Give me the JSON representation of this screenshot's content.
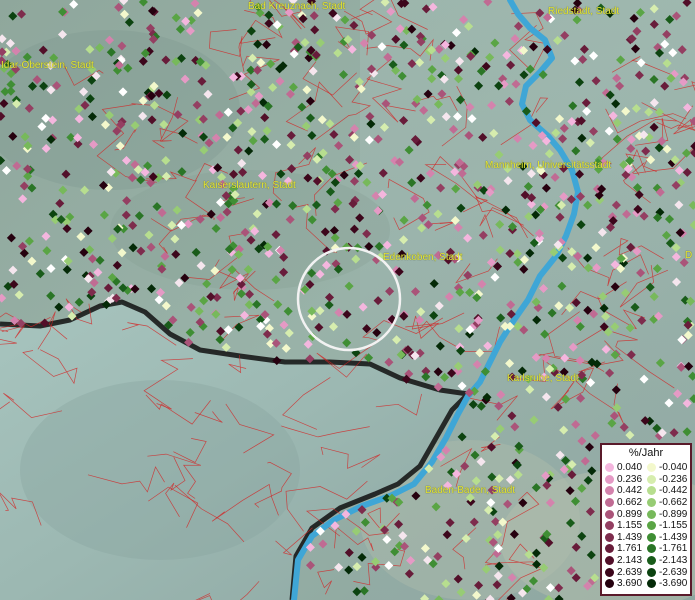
{
  "map": {
    "cities": [
      {
        "name": "Bad Kreuznach, Stadt"
      },
      {
        "name": "Riedstadt, Stadt"
      },
      {
        "name": "Idar-Oberstein, Stadt"
      },
      {
        "name": "Mannheim, Universitätsstadt"
      },
      {
        "name": "Kaiserslautern, Stadt"
      },
      {
        "name": "Edenkoben, Stadt"
      },
      {
        "name": "Karlsruhe, Stadt"
      },
      {
        "name": "Baden-Baden, Stadt"
      },
      {
        "name": "D"
      }
    ],
    "colors": {
      "city_label": "#e6e633",
      "boundary": "#d42020",
      "river": "#3fa6d6",
      "border": "#111111"
    }
  },
  "legend": {
    "title": "%/Jahr",
    "positive": [
      {
        "label": "0.040",
        "color": "#f4b6de"
      },
      {
        "label": "0.236",
        "color": "#e59ac5"
      },
      {
        "label": "0.442",
        "color": "#d483ad"
      },
      {
        "label": "0.662",
        "color": "#c06b93"
      },
      {
        "label": "0.899",
        "color": "#aa5479"
      },
      {
        "label": "1.155",
        "color": "#943f62"
      },
      {
        "label": "1.439",
        "color": "#7e2c4d"
      },
      {
        "label": "1.761",
        "color": "#681c3a"
      },
      {
        "label": "2.143",
        "color": "#520f29"
      },
      {
        "label": "2.639",
        "color": "#3c061b"
      },
      {
        "label": "3.690",
        "color": "#26010f"
      }
    ],
    "negative": [
      {
        "label": "-0.040",
        "color": "#f3f8cc"
      },
      {
        "label": "-0.236",
        "color": "#d6edae"
      },
      {
        "label": "-0.442",
        "color": "#b7de8f"
      },
      {
        "label": "-0.662",
        "color": "#97cc74"
      },
      {
        "label": "-0.899",
        "color": "#77b95b"
      },
      {
        "label": "-1.155",
        "color": "#5aa545"
      },
      {
        "label": "-1.439",
        "color": "#3f8e34"
      },
      {
        "label": "-1.761",
        "color": "#2a7526"
      },
      {
        "label": "-2.143",
        "color": "#195c1a"
      },
      {
        "label": "-2.639",
        "color": "#0c4310"
      },
      {
        "label": "-3.690",
        "color": "#042a07"
      }
    ]
  }
}
